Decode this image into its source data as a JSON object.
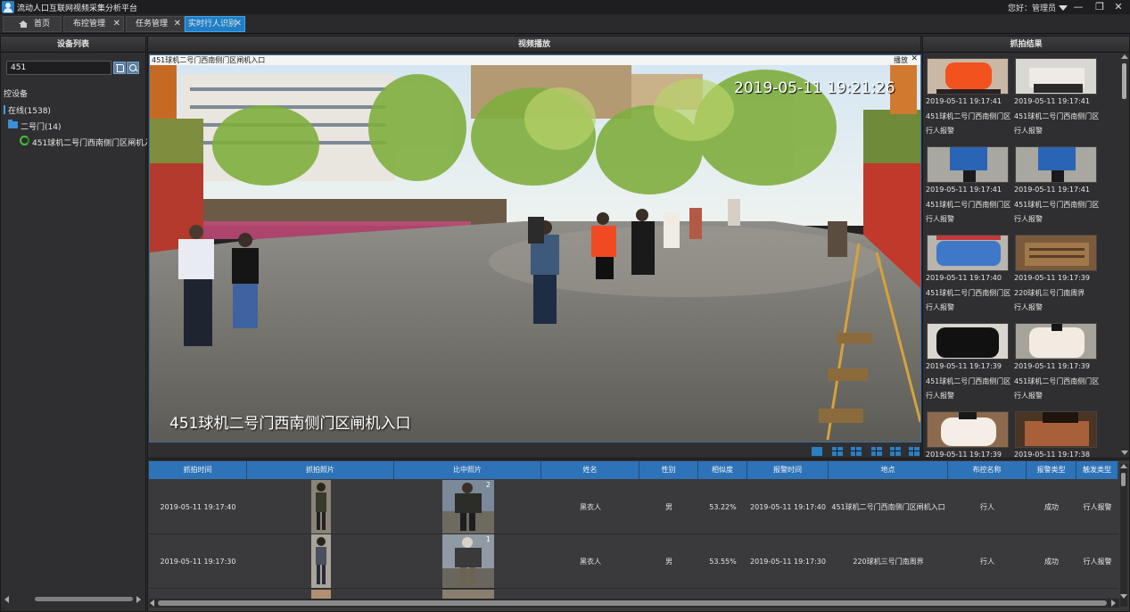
{
  "window": {
    "title": "流动人口互联网视频采集分析平台",
    "greeting": "您好：管理员",
    "minimize": "—",
    "restore": "❐",
    "close": "✕"
  },
  "tabs": [
    {
      "label": "首页",
      "closable": false,
      "active": false
    },
    {
      "label": "布控管理",
      "closable": true,
      "active": false
    },
    {
      "label": "任务管理",
      "closable": true,
      "active": false
    },
    {
      "label": "实时行人识别",
      "closable": true,
      "active": true
    }
  ],
  "tab_close_glyph": "✕",
  "device_panel": {
    "header": "设备列表",
    "search_value": "451",
    "tree": {
      "root": "控设备",
      "online": "在线(1538)",
      "group": "二号门(14)",
      "camera": "451球机二号门西南侧门区闸机入口"
    }
  },
  "video_panel": {
    "header": "视频播放",
    "window_title": "451球机二号门西南侧门区闸机入口",
    "play_label": "播放",
    "close_glyph": "✕",
    "timestamp": "2019-05-11 19:21:26",
    "overlay_text": "451球机二号门西南侧门区闸机入口"
  },
  "capture_panel": {
    "header": "抓拍结果",
    "items": [
      {
        "time": "2019-05-11 19:17:41",
        "location": "451球机二号门西南侧门区",
        "type": "行人报警",
        "thumb": "red-shirt"
      },
      {
        "time": "2019-05-11 19:17:41",
        "location": "451球机二号门西南侧门区",
        "type": "行人报警",
        "thumb": "white-pants"
      },
      {
        "time": "2019-05-11 19:17:41",
        "location": "451球机二号门西南侧门区",
        "type": "行人报警",
        "thumb": "blue-legs"
      },
      {
        "time": "2019-05-11 19:17:41",
        "location": "451球机二号门西南侧门区",
        "type": "行人报警",
        "thumb": "blue-legs-2"
      },
      {
        "time": "2019-05-11 19:17:40",
        "location": "451球机二号门西南侧门区",
        "type": "行人报警",
        "thumb": "blue-body"
      },
      {
        "time": "2019-05-11 19:17:39",
        "location": "220球机三号门南周界",
        "type": "行人报警",
        "thumb": "brown"
      },
      {
        "time": "2019-05-11 19:17:39",
        "location": "451球机二号门西南侧门区",
        "type": "行人报警",
        "thumb": "black"
      },
      {
        "time": "2019-05-11 19:17:39",
        "location": "451球机二号门西南侧门区",
        "type": "行人报警",
        "thumb": "white-top"
      },
      {
        "time": "2019-05-11 19:17:39",
        "location": "",
        "type": "",
        "thumb": "white-dress"
      },
      {
        "time": "2019-05-11 19:17:38",
        "location": "",
        "type": "",
        "thumb": "dark-brown"
      }
    ]
  },
  "alarm_table": {
    "columns": [
      "抓拍时间",
      "抓拍照片",
      "比中照片",
      "姓名",
      "性别",
      "相似度",
      "报警时间",
      "地点",
      "布控名称",
      "报警类型",
      "触发类型"
    ],
    "rows": [
      {
        "capture_time": "2019-05-11 19:17:40",
        "name": "黑衣人",
        "gender": "男",
        "similarity": "53.22%",
        "alarm_time": "2019-05-11 19:17:40",
        "location": "451球机二号门西南侧门区闸机入口",
        "control_name": "行人",
        "alarm_type": "成功",
        "trigger_type": "行人报警",
        "match_index": "2"
      },
      {
        "capture_time": "2019-05-11 19:17:30",
        "name": "黑衣人",
        "gender": "男",
        "similarity": "53.55%",
        "alarm_time": "2019-05-11 19:17:30",
        "location": "220球机三号门南周界",
        "control_name": "行人",
        "alarm_type": "成功",
        "trigger_type": "行人报警",
        "match_index": "1"
      }
    ]
  },
  "colors": {
    "accent": "#1e7fc6",
    "table_header": "#2e73b8",
    "background": "#2b2b2d"
  }
}
